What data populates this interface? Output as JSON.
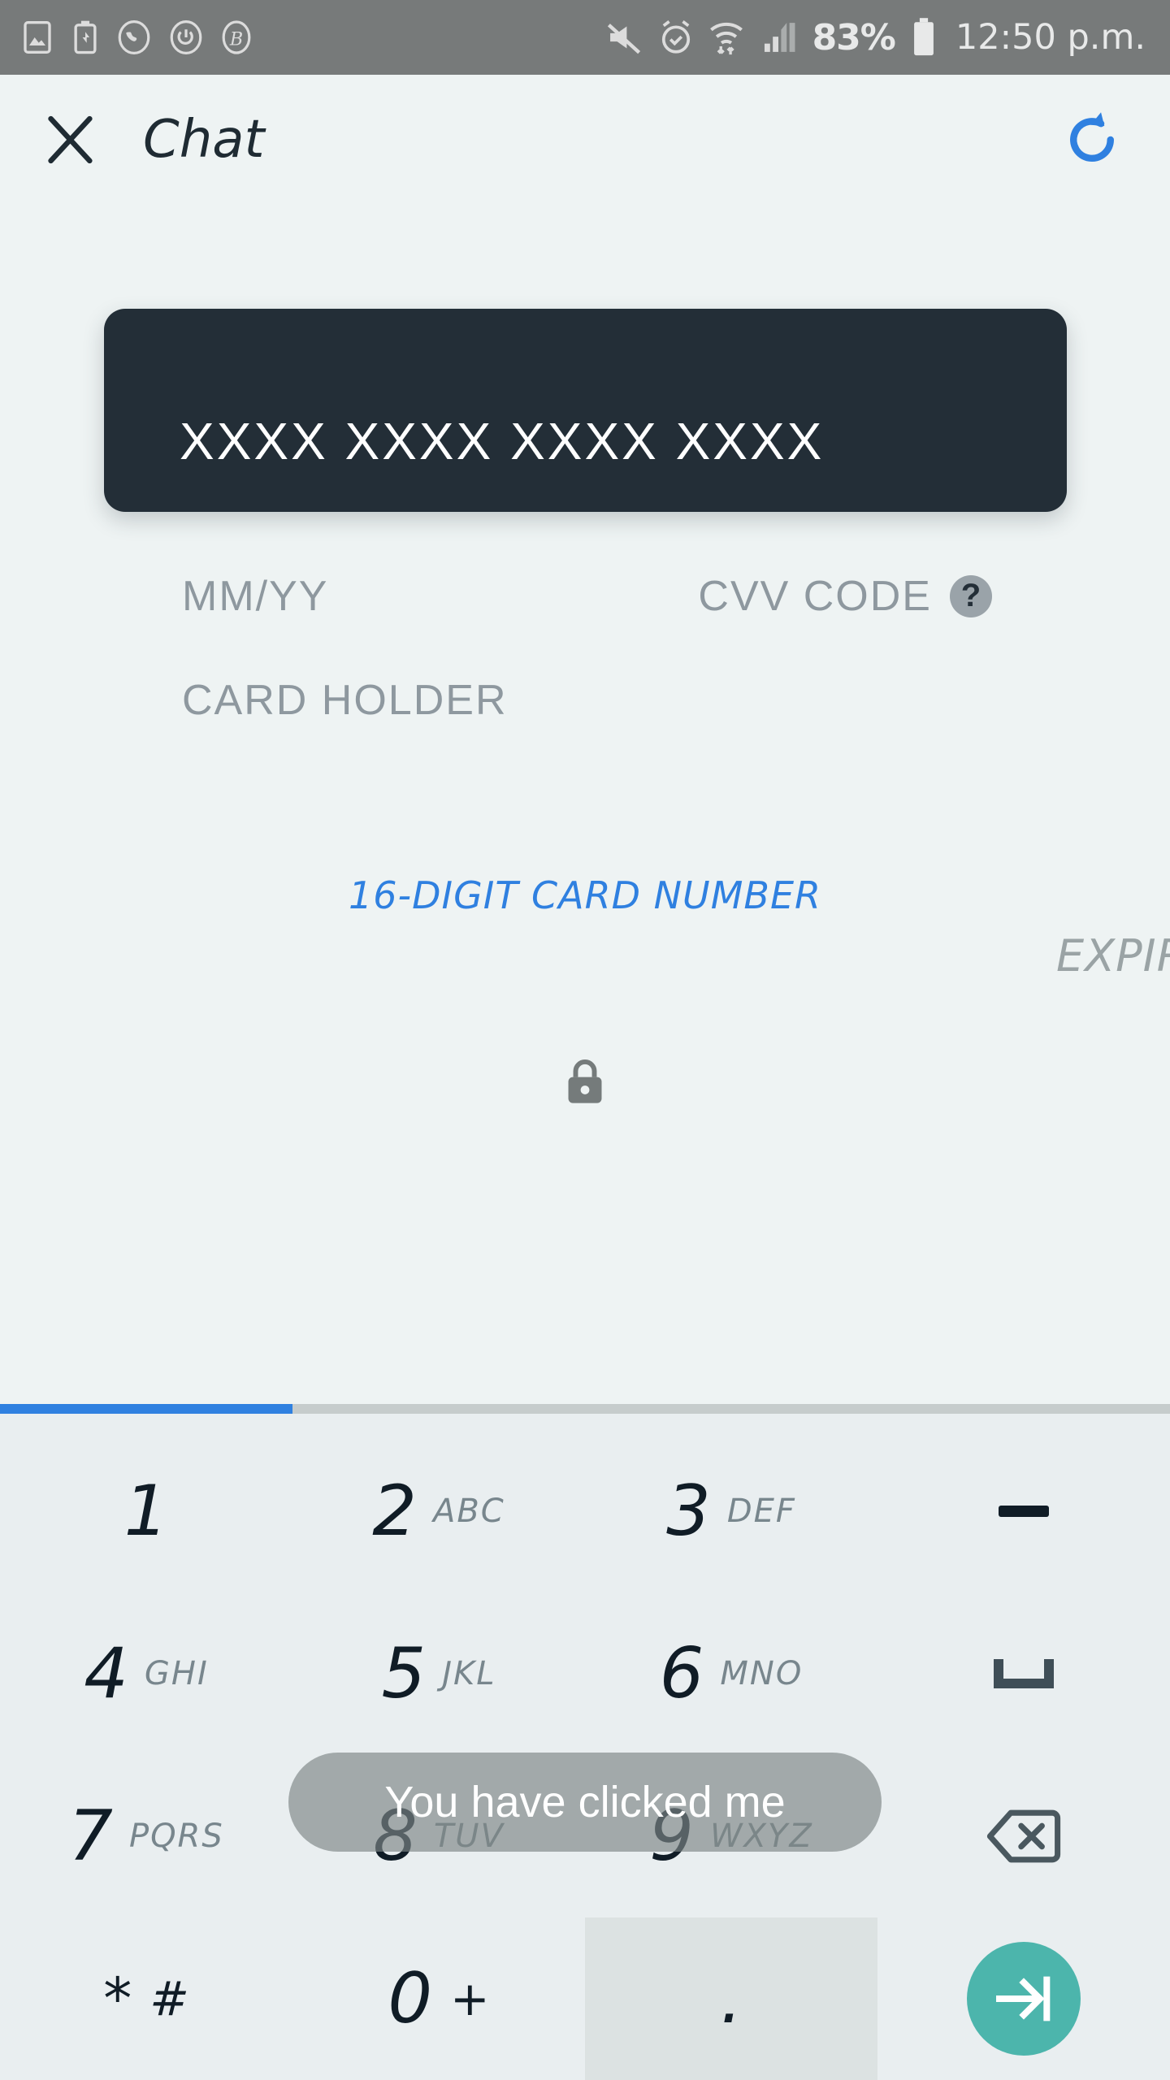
{
  "statusbar": {
    "left_icons": [
      "image-icon",
      "battery-saver-icon",
      "whatsapp-icon",
      "rotate-icon",
      "b-app-icon"
    ],
    "right_icons": [
      "mute-icon",
      "alarm-icon",
      "wifi-icon",
      "signal-icon"
    ],
    "battery_percent": "83%",
    "battery_icon": "battery-icon",
    "time": "12:50 p.m."
  },
  "appbar": {
    "close_icon": "close-icon",
    "title": "Chat",
    "refresh_icon": "refresh-icon",
    "accent_color": "#2f80e0"
  },
  "card": {
    "background_color": "#232e37",
    "number": "XXXX  XXXX  XXXX  XXXX",
    "expiry_placeholder": "MM/YY",
    "cvv_placeholder": "CVV  CODE",
    "cvv_help_icon": "help-icon",
    "cvv_help_glyph": "?",
    "holder_placeholder": "CARD  HOLDER"
  },
  "fields": {
    "active_label": "16-DIGIT CARD NUMBER",
    "active_label_color": "#2f80e0",
    "next_label": "EXPIRY",
    "next_label_color": "#9aa3a5",
    "lock_icon": "lock-icon"
  },
  "progress": {
    "percent": 25,
    "fill_color": "#2f80e0",
    "track_color": "#c6cccc"
  },
  "keyboard": {
    "rows": [
      [
        {
          "digit": "1",
          "letters": "",
          "name": "key-1"
        },
        {
          "digit": "2",
          "letters": "ABC",
          "name": "key-2"
        },
        {
          "digit": "3",
          "letters": "DEF",
          "name": "key-3"
        },
        {
          "digit": "",
          "letters": "",
          "name": "key-dash",
          "icon": "dash-icon"
        }
      ],
      [
        {
          "digit": "4",
          "letters": "GHI",
          "name": "key-4"
        },
        {
          "digit": "5",
          "letters": "JKL",
          "name": "key-5"
        },
        {
          "digit": "6",
          "letters": "MNO",
          "name": "key-6"
        },
        {
          "digit": "",
          "letters": "",
          "name": "key-space",
          "icon": "space-icon"
        }
      ],
      [
        {
          "digit": "7",
          "letters": "PQRS",
          "name": "key-7"
        },
        {
          "digit": "8",
          "letters": "TUV",
          "name": "key-8"
        },
        {
          "digit": "9",
          "letters": "WXYZ",
          "name": "key-9"
        },
        {
          "digit": "",
          "letters": "",
          "name": "key-backspace",
          "icon": "backspace-icon"
        }
      ],
      [
        {
          "digit": "*",
          "letters": "#",
          "name": "key-star-hash"
        },
        {
          "digit": "0",
          "letters": "+",
          "name": "key-0"
        },
        {
          "digit": ".",
          "letters": "",
          "name": "key-period",
          "pressed": true
        },
        {
          "digit": "",
          "letters": "",
          "name": "key-next",
          "icon": "next-icon"
        }
      ]
    ],
    "next_button_color": "#4cb5ac",
    "background_color": "#e9eef0"
  },
  "toast": {
    "message": "You have clicked me"
  }
}
